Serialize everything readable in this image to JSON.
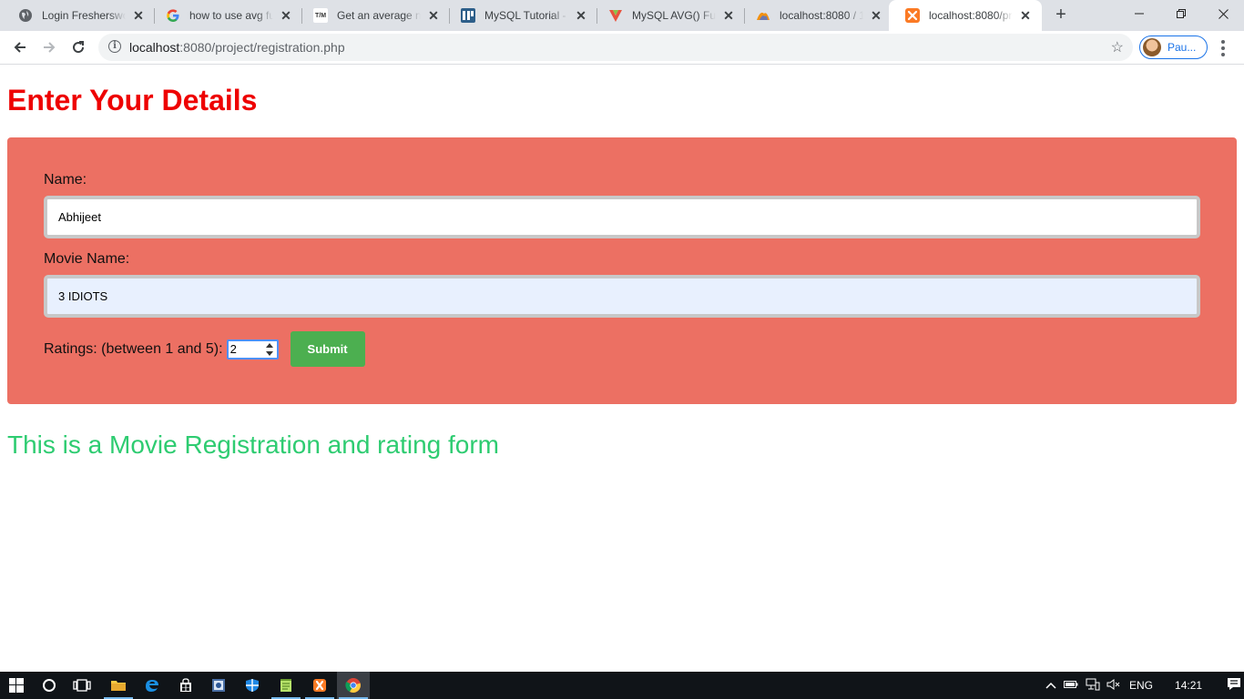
{
  "browser": {
    "tabs": [
      {
        "title": "Login Fresherswor",
        "icon": "globe-icon"
      },
      {
        "title": "how to use avg fu",
        "icon": "google-icon"
      },
      {
        "title": "Get an average nu",
        "icon": "tm-icon"
      },
      {
        "title": "MySQL Tutorial - A",
        "icon": "mysqltutorial-icon"
      },
      {
        "title": "MySQL AVG() Func",
        "icon": "mysql-avg-icon"
      },
      {
        "title": "localhost:8080 / 12",
        "icon": "phpmyadmin-icon"
      },
      {
        "title": "localhost:8080/pro",
        "icon": "xampp-icon",
        "active": true
      }
    ],
    "address": {
      "host": "localhost",
      "path": ":8080/project/registration.php"
    },
    "profile_name": "Pau..."
  },
  "page": {
    "heading": "Enter Your Details",
    "form": {
      "name_label": "Name:",
      "name_value": "Abhijeet",
      "movie_label": "Movie Name:",
      "movie_value": "3 IDIOTS",
      "ratings_label": "Ratings: (between 1 and 5):",
      "ratings_value": "2",
      "submit_label": "Submit"
    },
    "tagline": "This is a Movie Registration and rating form"
  },
  "taskbar": {
    "language": "ENG",
    "time": "14:21"
  },
  "colors": {
    "heading": "#ee0000",
    "panel": "#ec7063",
    "submit": "#4caf50",
    "tagline": "#2ecc71"
  }
}
